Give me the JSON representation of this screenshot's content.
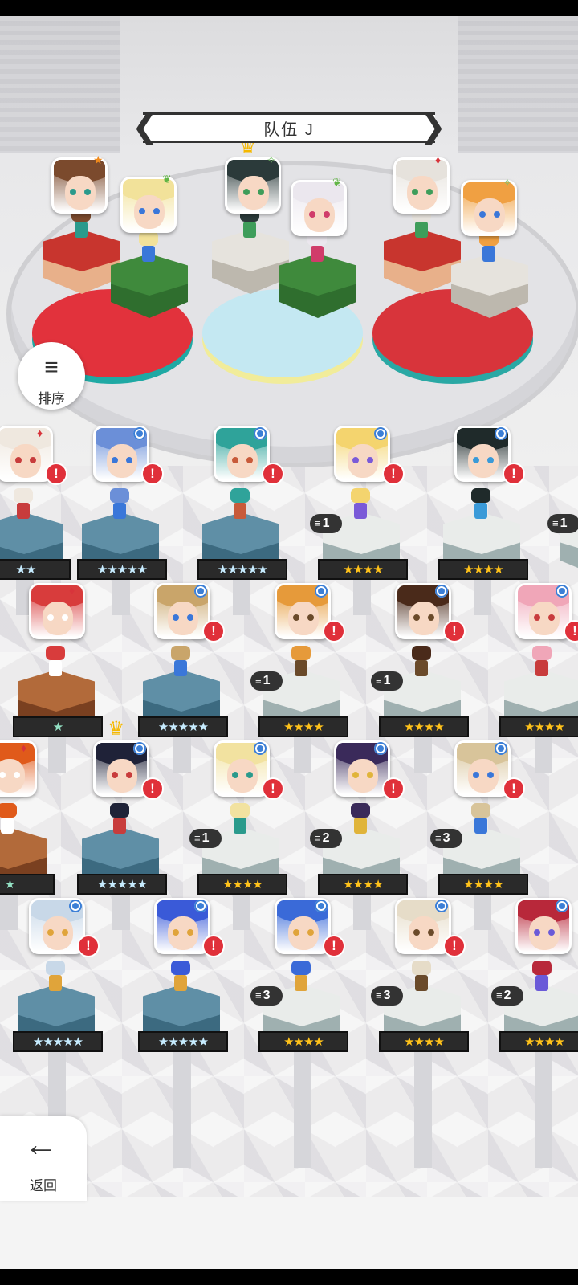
{
  "team": {
    "title": "队伍 J",
    "prev_arrow": "❮",
    "next_arrow": "❯"
  },
  "sort_button": {
    "label": "排序",
    "icon": "sort-icon"
  },
  "back_button": {
    "label": "返回",
    "icon": "back-arrow-icon"
  },
  "colors": {
    "red": "#d8343b",
    "green": "#3f8a3c",
    "blue_badge": "#3c7fd6",
    "alert": "#e0303a",
    "gold_star": "#ffc21a"
  },
  "party": [
    {
      "slot": 1,
      "mark": "★",
      "mark_color": "#f08a1c",
      "hair": "#7b4a2d",
      "eye": "#2a9a8c",
      "pedestal": "red"
    },
    {
      "slot": 2,
      "mark": "leaf",
      "mark_color": "#61b545",
      "hair": "#f2e29a",
      "eye": "#3a77d9",
      "pedestal": "green"
    },
    {
      "slot": 3,
      "mark": "✧",
      "mark_color": "#7cc26a",
      "hair": "#2b3a3a",
      "eye": "#3e9d5a",
      "pedestal": "gray",
      "leader": true
    },
    {
      "slot": 4,
      "mark": "leaf",
      "mark_color": "#61b545",
      "hair": "#ebe7ee",
      "eye": "#d03c6a",
      "pedestal": "green"
    },
    {
      "slot": 5,
      "mark": "♦",
      "mark_color": "#d8343b",
      "hair": "#e6e2dc",
      "eye": "#3e9d5a",
      "pedestal": "red"
    },
    {
      "slot": 6,
      "mark": "✧",
      "mark_color": "#7cc26a",
      "hair": "#f0a042",
      "eye": "#3a77d9",
      "pedestal": "gray"
    }
  ],
  "roster": [
    [
      {
        "hair": "#efe8df",
        "eye": "#c83c3c",
        "stars": "★★",
        "star_type": "silver",
        "count": "",
        "mark": "♦",
        "alert": true
      },
      {
        "hair": "#6b8fd8",
        "eye": "#3a77d9",
        "stars": "★★★★★",
        "star_type": "silver",
        "count": "",
        "mark": "dot",
        "alert": true
      },
      {
        "hair": "#2fa39a",
        "eye": "#c85a3a",
        "stars": "★★★★★",
        "star_type": "silver",
        "count": "",
        "mark": "dot",
        "alert": true
      },
      {
        "hair": "#f4d46e",
        "eye": "#7a5ad8",
        "stars": "★★★★",
        "star_type": "gold",
        "count": "1",
        "mark": "dot",
        "alert": true
      },
      {
        "hair": "#1f2a2a",
        "eye": "#3a9ad8",
        "stars": "★★★★",
        "star_type": "gold",
        "count": "",
        "mark": "dot",
        "alert": true
      },
      {
        "hair": "#444",
        "eye": "#333",
        "stars": "",
        "star_type": "gold",
        "count": "1",
        "mark": "",
        "alert": false
      }
    ],
    [
      {
        "hair": "#d83c3c",
        "eye": "#fff",
        "stars": "★",
        "star_type": "green",
        "count": "",
        "mark": "♦",
        "alert": false
      },
      {
        "hair": "#c9a56a",
        "eye": "#3a77d9",
        "stars": "★★★★★",
        "star_type": "silver",
        "count": "",
        "mark": "dot",
        "alert": true
      },
      {
        "hair": "#e69a3a",
        "eye": "#6a4a2a",
        "stars": "★★★★",
        "star_type": "gold",
        "count": "1",
        "mark": "dot",
        "alert": true
      },
      {
        "hair": "#4a2a1a",
        "eye": "#6a4a2a",
        "stars": "★★★★",
        "star_type": "gold",
        "count": "1",
        "mark": "dot",
        "alert": true
      },
      {
        "hair": "#f0a6b8",
        "eye": "#c83c3c",
        "stars": "★★★★",
        "star_type": "gold",
        "count": "",
        "mark": "dot",
        "alert": true
      }
    ],
    [
      {
        "hair": "#e05a1a",
        "eye": "#fff",
        "stars": "★",
        "star_type": "green",
        "count": "",
        "mark": "♦",
        "alert": false
      },
      {
        "hair": "#1f2238",
        "eye": "#c83c3c",
        "stars": "★★★★★",
        "star_type": "silver",
        "count": "",
        "mark": "dot",
        "alert": true,
        "leader": true
      },
      {
        "hair": "#f2e2a0",
        "eye": "#2a9a8c",
        "stars": "★★★★",
        "star_type": "gold",
        "count": "1",
        "mark": "dot",
        "alert": true
      },
      {
        "hair": "#3a2a5a",
        "eye": "#e0b43a",
        "stars": "★★★★",
        "star_type": "gold",
        "count": "2",
        "mark": "dot",
        "alert": true
      },
      {
        "hair": "#d8c49a",
        "eye": "#3a77d9",
        "stars": "★★★★",
        "star_type": "gold",
        "count": "3",
        "mark": "dot",
        "alert": true
      }
    ],
    [
      {
        "hair": "#c8d8e8",
        "eye": "#e0a43a",
        "stars": "★★★★★",
        "star_type": "silver",
        "count": "",
        "mark": "dot",
        "alert": true
      },
      {
        "hair": "#3a5ad8",
        "eye": "#e0a43a",
        "stars": "★★★★★",
        "star_type": "silver",
        "count": "",
        "mark": "dot",
        "alert": true
      },
      {
        "hair": "#3a6ad8",
        "eye": "#e0a43a",
        "stars": "★★★★",
        "star_type": "gold",
        "count": "3",
        "mark": "dot",
        "alert": true
      },
      {
        "hair": "#e6dcc8",
        "eye": "#6a4a2a",
        "stars": "★★★★",
        "star_type": "gold",
        "count": "3",
        "mark": "dot",
        "alert": true
      },
      {
        "hair": "#b8283a",
        "eye": "#6a5ad8",
        "stars": "★★★★",
        "star_type": "gold",
        "count": "2",
        "mark": "dot",
        "alert": false
      }
    ]
  ]
}
